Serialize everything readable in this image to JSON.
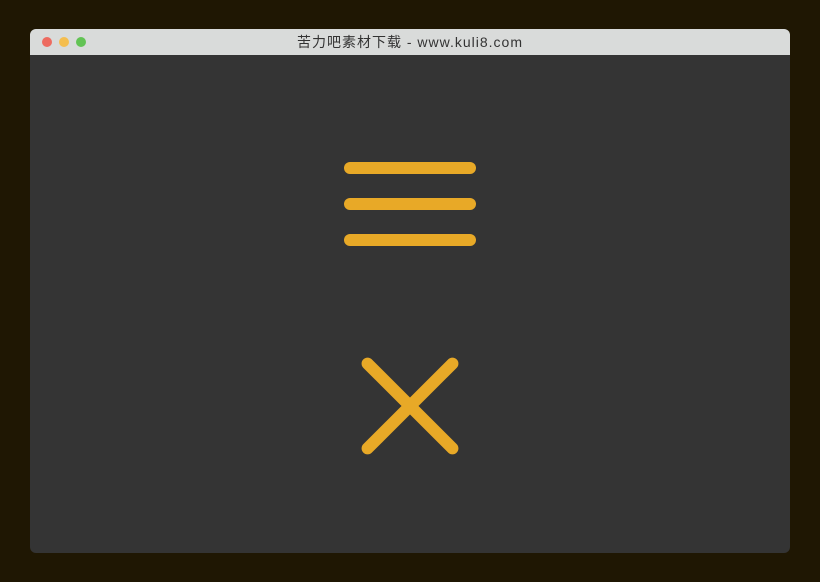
{
  "window": {
    "title": "苦力吧素材下载 - www.kuli8.com"
  },
  "colors": {
    "accent": "#e8a927",
    "background": "#343434",
    "page": "#1f1703"
  },
  "icons": {
    "hamburger": "hamburger-menu-icon",
    "close": "close-x-icon"
  }
}
